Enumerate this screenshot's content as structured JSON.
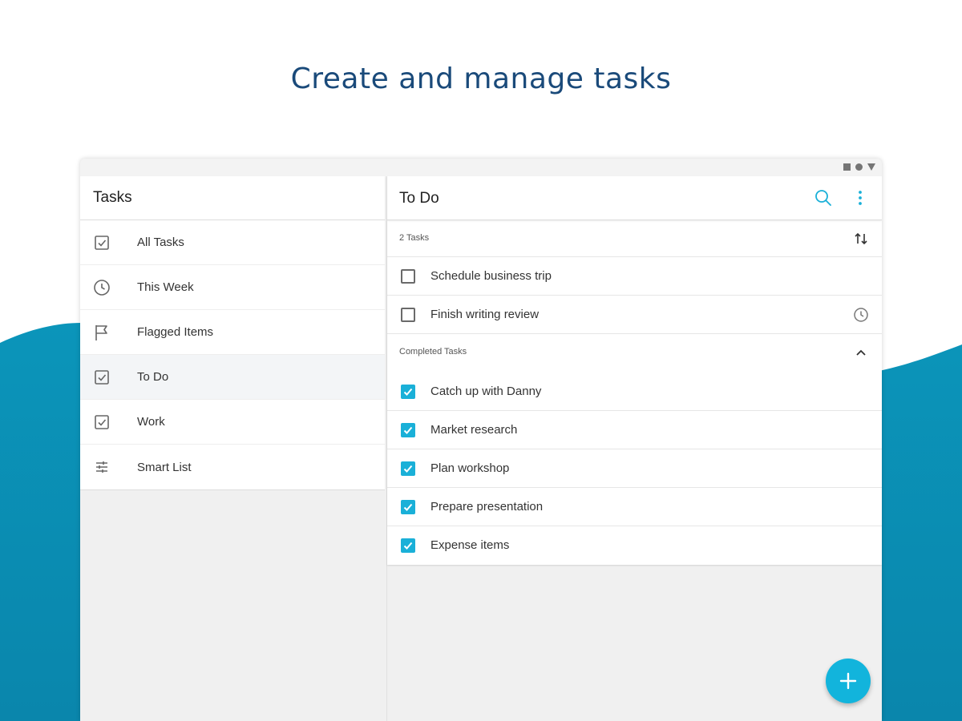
{
  "headline": "Create and manage tasks",
  "colors": {
    "accent": "#1ab0d8",
    "headline": "#1a4a7a",
    "wave": "#0b93b8"
  },
  "left_pane": {
    "title": "Tasks",
    "items": [
      {
        "label": "All Tasks",
        "icon": "checkbox-icon"
      },
      {
        "label": "This Week",
        "icon": "clock-icon"
      },
      {
        "label": "Flagged Items",
        "icon": "flag-icon"
      },
      {
        "label": "To Do",
        "icon": "checkbox-icon",
        "active": true
      },
      {
        "label": "Work",
        "icon": "checkbox-icon"
      },
      {
        "label": "Smart List",
        "icon": "filter-sliders-icon"
      }
    ]
  },
  "right_pane": {
    "title": "To Do",
    "task_count": "2 Tasks",
    "open_tasks": [
      {
        "label": "Schedule business trip",
        "reminder": false
      },
      {
        "label": "Finish writing review",
        "reminder": true
      }
    ],
    "completed_label": "Completed Tasks",
    "completed_tasks": [
      "Catch up with Danny",
      "Market research",
      "Plan workshop",
      "Prepare presentation",
      "Expense items"
    ]
  }
}
